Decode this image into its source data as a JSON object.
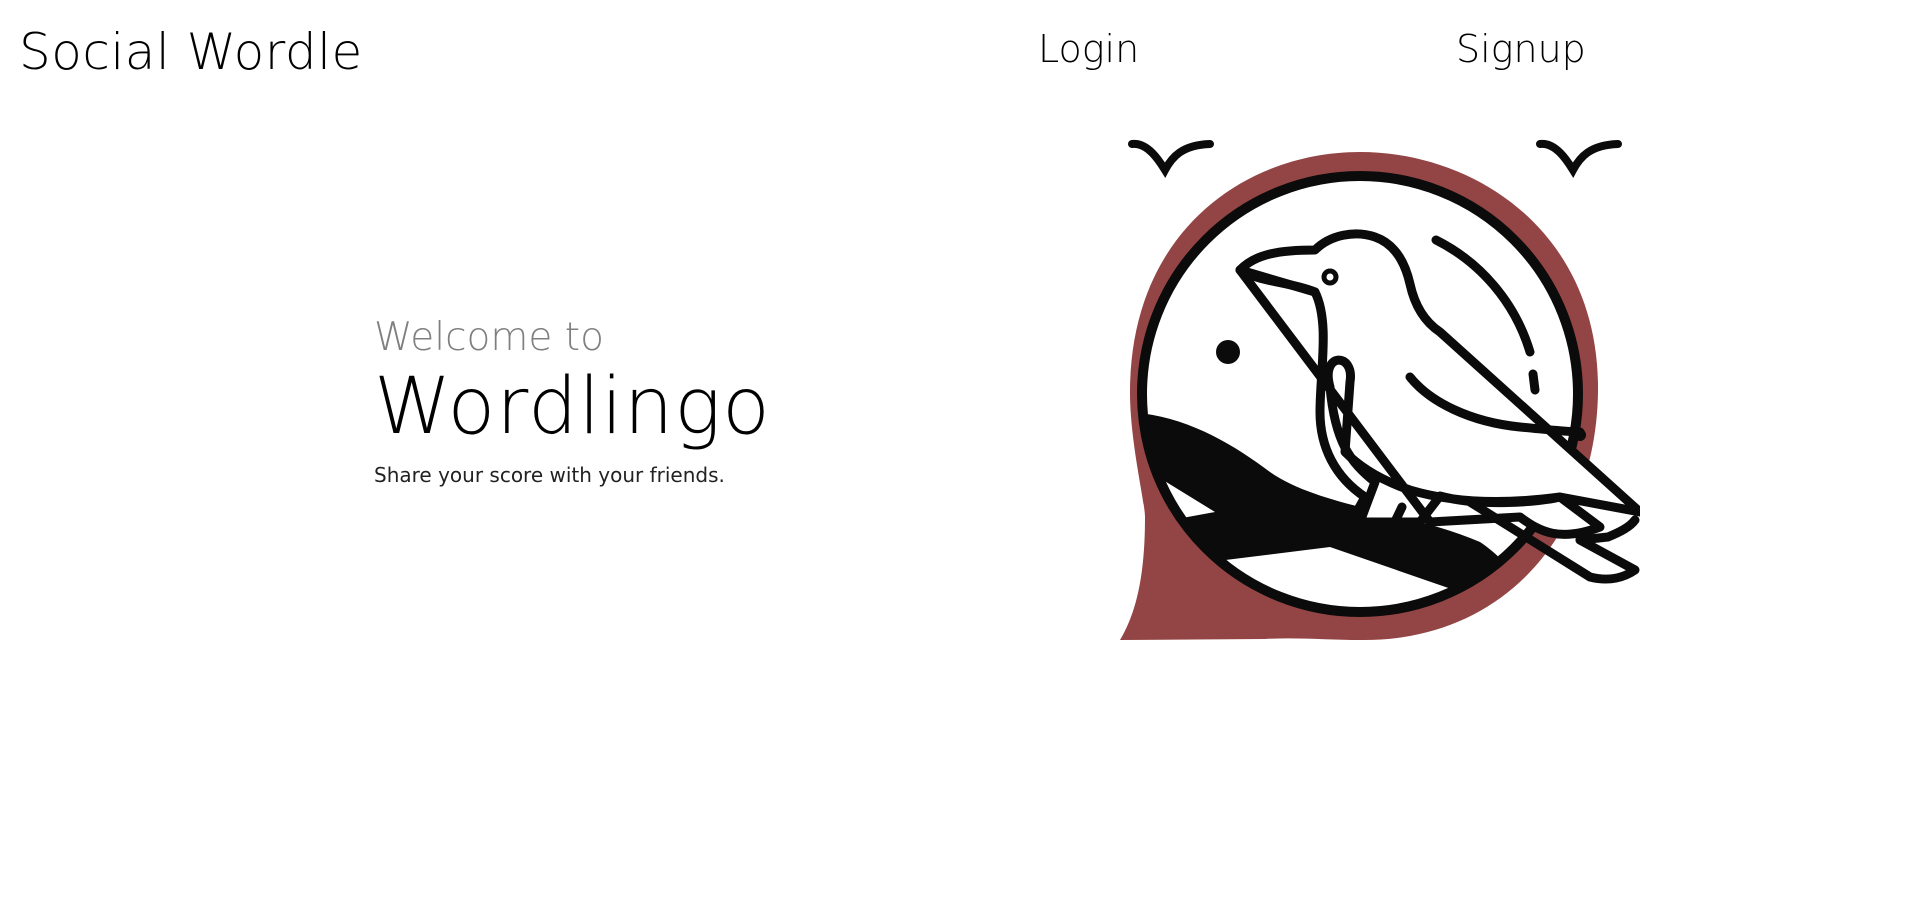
{
  "header": {
    "brand": "Social Wordle",
    "nav": {
      "login_label": "Login",
      "signup_label": "Signup"
    }
  },
  "hero": {
    "kicker": "Welcome to",
    "title": "Wordlingo",
    "subtitle": "Share your score with your friends."
  },
  "illustration": {
    "icon": "bird-on-branch-chat-bubble-icon",
    "accent_color": "#934545",
    "stroke_color": "#0b0b0b"
  }
}
